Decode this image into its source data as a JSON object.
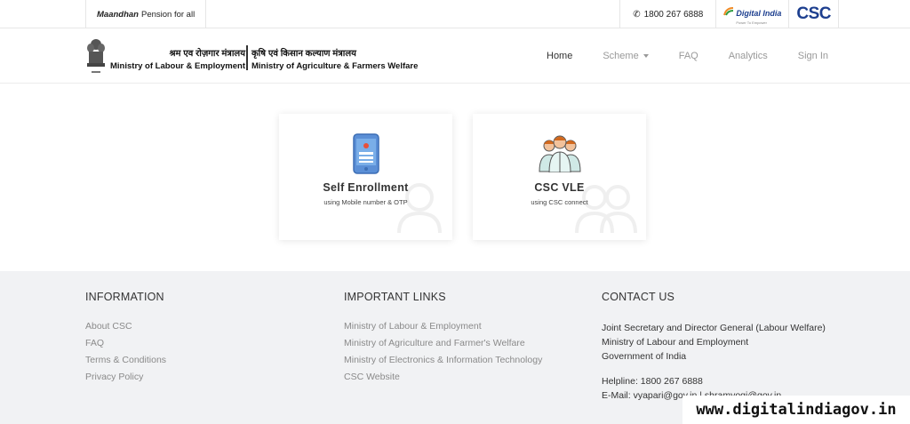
{
  "topbar": {
    "tagline_bold": "Maandhan",
    "tagline_rest": "Pension for all",
    "phone": "1800 267 6888",
    "digital_india": "Digital India",
    "digital_india_sub": "Power To Empower",
    "csc": "CSC"
  },
  "header": {
    "ministry1_hi": "श्रम एव रोज़गार मंत्रालय",
    "ministry1_en": "Ministry of Labour & Employment",
    "ministry2_hi": "कृषि एवं किसान कल्याण मंत्रालय",
    "ministry2_en": "Ministry of Agriculture & Farmers Welfare",
    "nav": {
      "home": "Home",
      "scheme": "Scheme",
      "faq": "FAQ",
      "analytics": "Analytics",
      "signin": "Sign In"
    }
  },
  "cards": [
    {
      "title": "Self Enrollment",
      "subtitle": "using Mobile number & OTP",
      "icon": "mobile-phone-icon"
    },
    {
      "title": "CSC VLE",
      "subtitle": "using CSC connect",
      "icon": "group-users-icon"
    }
  ],
  "footer": {
    "information": {
      "heading": "INFORMATION",
      "links": [
        "About CSC",
        "FAQ",
        "Terms & Conditions",
        "Privacy Policy"
      ]
    },
    "important_links": {
      "heading": "IMPORTANT LINKS",
      "links": [
        "Ministry of Labour & Employment",
        "Ministry of Agriculture and Farmer's Welfare",
        "Ministry of Electronics & Information Technology",
        "CSC Website"
      ]
    },
    "contact": {
      "heading": "CONTACT US",
      "lines": [
        "Joint Secretary and Director General (Labour Welfare)",
        "Ministry of Labour and Employment",
        "Government of India"
      ],
      "helpline": "Helpline: 1800 267 6888",
      "email": "E-Mail: vyapari@gov.in | shramyogi@gov.in"
    }
  },
  "watermark": "www.digitalindiagov.in",
  "colors": {
    "brand_blue": "#1d3f8f",
    "footer_bg": "#f1f2f4"
  }
}
